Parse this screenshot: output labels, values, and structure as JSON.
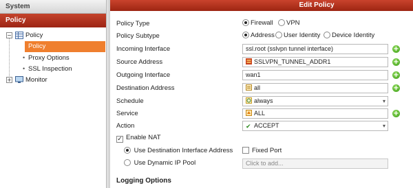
{
  "nav": {
    "system_label": "System",
    "policy_label": "Policy",
    "tree": [
      {
        "label": "Policy",
        "expander": "−"
      },
      {
        "label": "Policy",
        "selected": true
      },
      {
        "label": "Proxy Options"
      },
      {
        "label": "SSL Inspection"
      },
      {
        "label": "Monitor",
        "expander": "+"
      }
    ]
  },
  "form": {
    "title": "Edit Policy",
    "policy_type": {
      "label": "Policy Type",
      "options": [
        "Firewall",
        "VPN"
      ],
      "selected": "Firewall"
    },
    "policy_subtype": {
      "label": "Policy Subtype",
      "options": [
        "Address",
        "User Identity",
        "Device Identity"
      ],
      "selected": "Address"
    },
    "incoming_interface": {
      "label": "Incoming Interface",
      "value": "ssl.root (sslvpn tunnel interface)"
    },
    "source_address": {
      "label": "Source Address",
      "value": "SSLVPN_TUNNEL_ADDR1"
    },
    "outgoing_interface": {
      "label": "Outgoing Interface",
      "value": "wan1"
    },
    "destination_address": {
      "label": "Destination Address",
      "value": "all"
    },
    "schedule": {
      "label": "Schedule",
      "value": "always"
    },
    "service": {
      "label": "Service",
      "value": "ALL"
    },
    "action": {
      "label": "Action",
      "value": "ACCEPT"
    },
    "enable_nat": {
      "label": "Enable NAT",
      "checked": true
    },
    "use_dest_iface_addr": {
      "label": "Use Destination Interface Address",
      "selected": true
    },
    "fixed_port": {
      "label": "Fixed Port",
      "checked": false
    },
    "use_dynamic_ip_pool": {
      "label": "Use Dynamic IP Pool",
      "selected": false
    },
    "ip_pool_placeholder": "Click to add...",
    "logging_options": "Logging Options"
  },
  "colors": {
    "accent": "#b3321e",
    "selected_nav": "#ef7f2e",
    "add_button": "#4caf25"
  }
}
